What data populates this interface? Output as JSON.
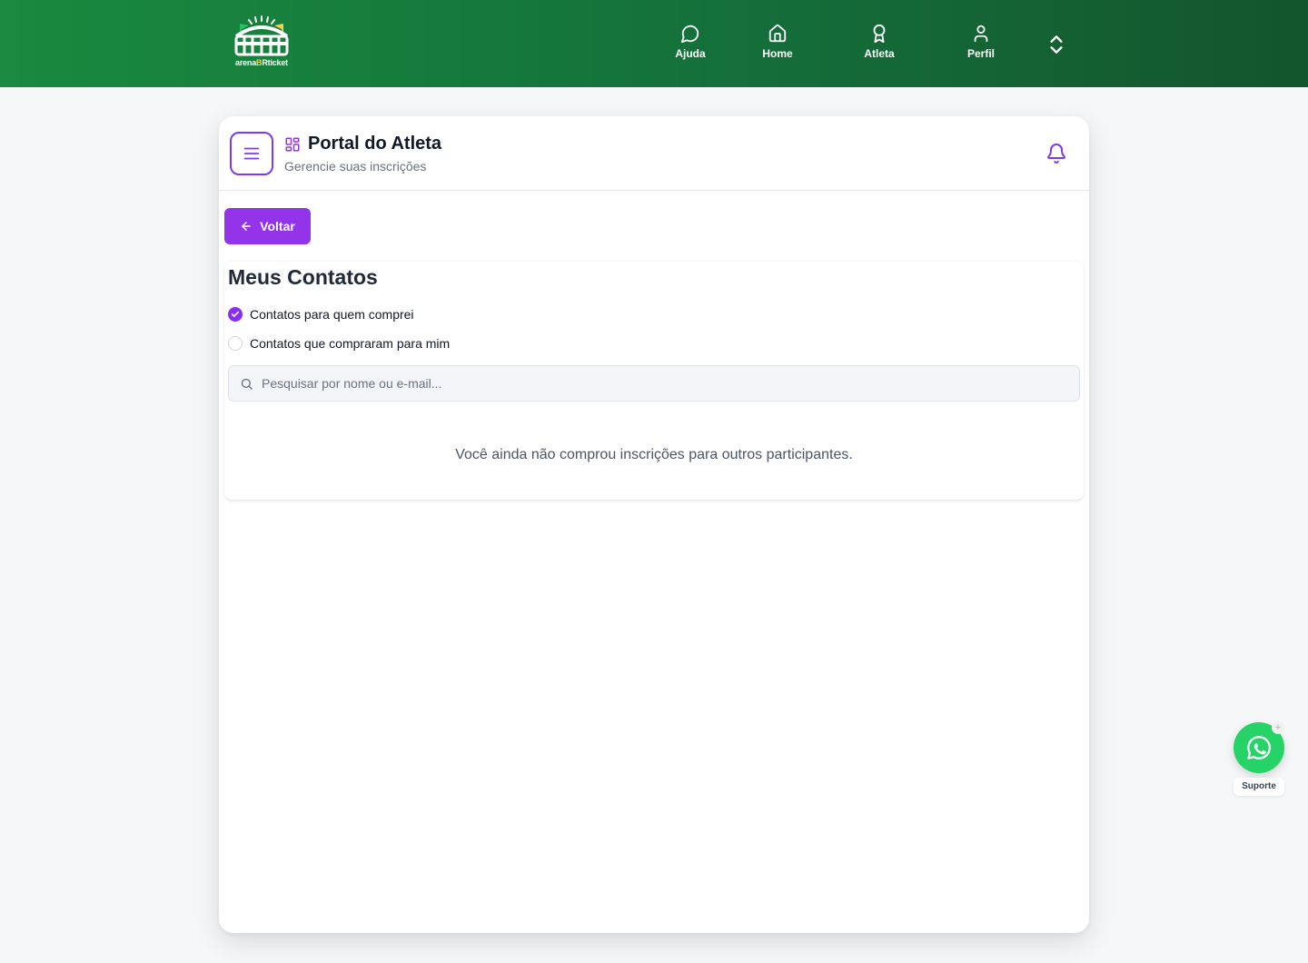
{
  "header": {
    "logo": {
      "text_start": "arena",
      "text_mid": "B",
      "text_end": "Rticket",
      "colors": {
        "white": "#ffffff",
        "yellow": "#f5d547",
        "green_flag": "#22c55e"
      }
    },
    "nav": [
      {
        "label": "Ajuda",
        "icon": "chat-bubble-icon"
      },
      {
        "label": "Home",
        "icon": "home-icon"
      },
      {
        "label": "Atleta",
        "icon": "medal-icon"
      },
      {
        "label": "Perfil",
        "icon": "user-icon"
      }
    ],
    "toggle_icon": "chevron-up-down-icon",
    "gradient": [
      "#198a3f",
      "#14703a",
      "#13552e"
    ]
  },
  "portal": {
    "title": "Portal do Atleta",
    "subtitle": "Gerencie suas inscrições",
    "icon": "grid-icon",
    "bell_icon": "bell-icon",
    "accent": "#7c3aed"
  },
  "back_button": {
    "label": "Voltar",
    "color": "#9333ea"
  },
  "contacts": {
    "title": "Meus Contatos",
    "options": [
      {
        "label": "Contatos para quem comprei",
        "selected": true
      },
      {
        "label": "Contatos que compraram para mim",
        "selected": false
      }
    ],
    "search": {
      "placeholder": "Pesquisar por nome ou e-mail...",
      "value": ""
    },
    "empty_message": "Você ainda não comprou inscrições para outros participantes."
  },
  "support": {
    "label": "Suporte",
    "plus": "+",
    "icon": "whatsapp-icon",
    "color": "#25d366"
  }
}
